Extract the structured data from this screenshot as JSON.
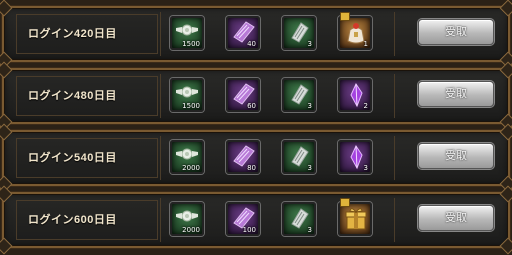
{
  "rows": [
    {
      "label": "ログイン420日目",
      "rewards": [
        {
          "icon": "green-emblem-icon",
          "qty": "1500"
        },
        {
          "icon": "purple-scroll-icon",
          "qty": "40"
        },
        {
          "icon": "green-scroll-icon",
          "qty": "3"
        },
        {
          "icon": "treasure-bag-icon",
          "qty": "1"
        }
      ],
      "button": "受取"
    },
    {
      "label": "ログイン480日目",
      "rewards": [
        {
          "icon": "green-emblem-icon",
          "qty": "1500"
        },
        {
          "icon": "purple-scroll-icon",
          "qty": "60"
        },
        {
          "icon": "green-scroll-icon",
          "qty": "3"
        },
        {
          "icon": "purple-crystal-icon",
          "qty": "2"
        }
      ],
      "button": "受取"
    },
    {
      "label": "ログイン540日目",
      "rewards": [
        {
          "icon": "green-emblem-icon",
          "qty": "2000"
        },
        {
          "icon": "purple-scroll-icon",
          "qty": "80"
        },
        {
          "icon": "green-scroll-icon",
          "qty": "3"
        },
        {
          "icon": "purple-crystal-icon",
          "qty": "3"
        }
      ],
      "button": "受取"
    },
    {
      "label": "ログイン600日目",
      "rewards": [
        {
          "icon": "green-emblem-icon",
          "qty": "2000"
        },
        {
          "icon": "purple-scroll-icon",
          "qty": "100"
        },
        {
          "icon": "green-scroll-icon",
          "qty": "3"
        },
        {
          "icon": "gold-gift-box-icon",
          "qty": ""
        }
      ],
      "button": "受取"
    }
  ]
}
